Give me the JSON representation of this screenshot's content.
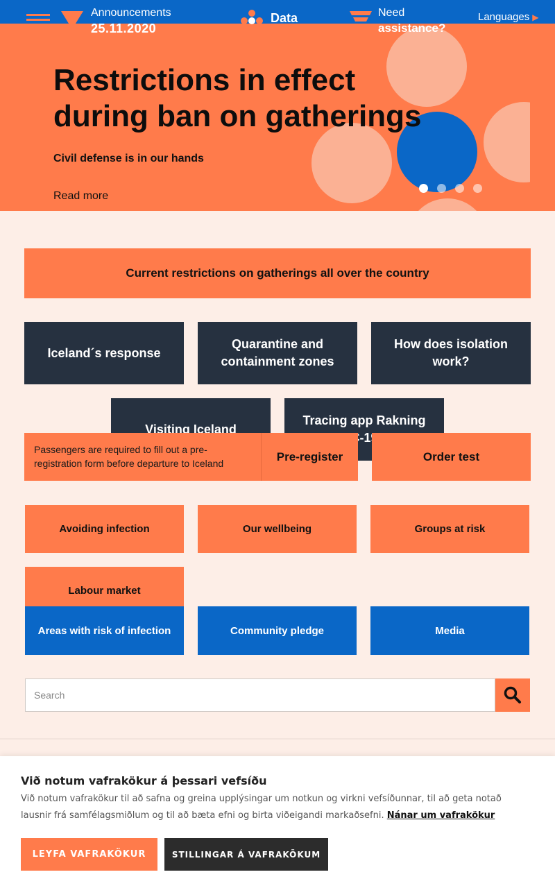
{
  "header": {
    "announcements_label": "Announcements",
    "announcements_date": "25.11.2020",
    "data_label": "Data",
    "need_label": "Need",
    "assistance_label": "assistance?",
    "languages_label": "Languages",
    "languages_arrow": "▶"
  },
  "hero": {
    "title": "Restrictions in effect during ban on gatherings",
    "subtitle": "Civil defense is in our hands",
    "read_more": "Read more",
    "slide_count": 4,
    "active_slide": 1
  },
  "tiles": {
    "wide": "Current restrictions on gatherings all over the country",
    "response": "Iceland´s response",
    "quarantine": "Quarantine and containment zones",
    "isolation": "How does isolation work?",
    "visiting": "Visiting Iceland",
    "tracing": "Tracing app Rakning C-19"
  },
  "prereg": {
    "text": "Passengers are required to fill out a pre-registration form before departure to Iceland",
    "button": "Pre-register"
  },
  "order_test": "Order test",
  "topics": {
    "avoiding": "Avoiding infection",
    "wellbeing": "Our wellbeing",
    "groups": "Groups at risk",
    "labour": "Labour market",
    "areas": "Areas with risk of infection",
    "pledge": "Community pledge",
    "media": "Media"
  },
  "search": {
    "placeholder": "Search"
  },
  "cookie": {
    "title": "Við notum vafrakökur á þessari vefsíðu",
    "body": "Við notum vafrakökur til að safna og greina upplýsingar um notkun og virkni vefsíðunnar, til að geta notað lausnir frá samfélagsmiðlum og til að bæta efni og birta viðeigandi markaðsefni.",
    "link": "Nánar um vafrakökur",
    "allow_button": "LEYFA VAFRAKÖKUR",
    "settings_button": "STILLINGAR Á VAFRAKÖKUM"
  },
  "colors": {
    "brand_blue": "#0a67c7",
    "brand_orange": "#ff7b4b",
    "dark_tile": "#263140",
    "background": "#fdeee7"
  }
}
